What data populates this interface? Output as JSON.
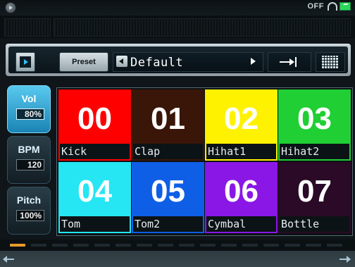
{
  "status": {
    "audio_label": "OFF",
    "icons": [
      "app-icon",
      "headphones-icon",
      "battery-icon"
    ]
  },
  "toolbar": {
    "preset_label": "Preset",
    "preset_value": "Default",
    "icons": [
      "play-icon",
      "left-arrow-icon",
      "right-arrow-icon",
      "skip-to-end-icon",
      "grid-icon"
    ]
  },
  "controls": [
    {
      "label": "Vol",
      "value": "80%",
      "active": true
    },
    {
      "label": "BPM",
      "value": "120",
      "active": false
    },
    {
      "label": "Pitch",
      "value": "100%",
      "active": false
    }
  ],
  "pads": [
    {
      "number": "00",
      "name": "Kick",
      "color": "#ff0000",
      "text_color": "#ffffff"
    },
    {
      "number": "01",
      "name": "Clap",
      "color": "#3a1608",
      "text_color": "#ffffff"
    },
    {
      "number": "02",
      "name": "Hihat1",
      "color": "#fff200",
      "text_color": "#ffffff"
    },
    {
      "number": "03",
      "name": "Hihat2",
      "color": "#1fcf33",
      "text_color": "#ffffff"
    },
    {
      "number": "04",
      "name": "Tom",
      "color": "#25e6f2",
      "text_color": "#ffffff"
    },
    {
      "number": "05",
      "name": "Tom2",
      "color": "#0f5ee6",
      "text_color": "#ffffff"
    },
    {
      "number": "06",
      "name": "Cymbal",
      "color": "#8a17e6",
      "text_color": "#ffffff"
    },
    {
      "number": "07",
      "name": "Bottle",
      "color": "#2a0a26",
      "text_color": "#ffffff"
    }
  ],
  "sequencer": {
    "steps": 16,
    "current_step": 1
  },
  "nav": {
    "icons": [
      "arrow-left-icon",
      "arrow-right-icon"
    ]
  }
}
